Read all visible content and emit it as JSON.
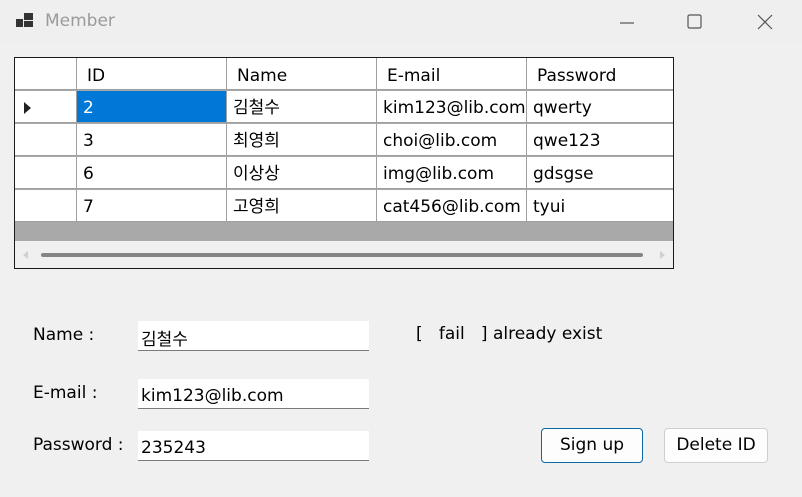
{
  "window": {
    "title": "Member",
    "icon": "app-window-icon",
    "controls": [
      "minimize-icon",
      "maximize-icon",
      "close-icon"
    ]
  },
  "grid": {
    "columns": [
      "ID",
      "Name",
      "E-mail",
      "Password"
    ],
    "rows": [
      {
        "id": "2",
        "name": "김철수",
        "email": "kim123@lib.com",
        "password": "qwerty"
      },
      {
        "id": "3",
        "name": "최영희",
        "email": "choi@lib.com",
        "password": "qwe123"
      },
      {
        "id": "6",
        "name": "이상상",
        "email": "img@lib.com",
        "password": "gdsgse"
      },
      {
        "id": "7",
        "name": "고영희",
        "email": "cat456@lib.com",
        "password": "tyui"
      }
    ],
    "selected_row": 0,
    "selection_color": "#0078d7"
  },
  "form": {
    "name_label": "Name :",
    "name_value": "김철수",
    "email_label": "E-mail :",
    "email_value": "kim123@lib.com",
    "password_label": "Password :",
    "password_value": "235243",
    "status_text": "[   fail   ] already exist"
  },
  "buttons": {
    "signup": "Sign up",
    "delete": "Delete ID"
  }
}
